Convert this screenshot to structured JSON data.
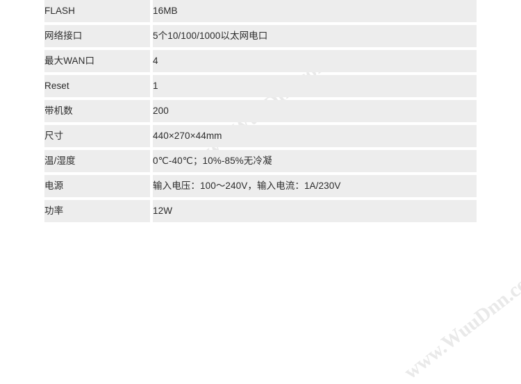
{
  "document": {
    "type": "product-specification-table",
    "columns": [
      "spec_name",
      "spec_value"
    ],
    "background_color": "#ffffff",
    "cell_color": "#ededed",
    "text_color": "#2b2b2b"
  },
  "watermarks": [
    {
      "text": "www.WuuDnn.com",
      "color": "#e9e9e9",
      "rotation": "-38deg"
    },
    {
      "text": "www.WuuDnn.com",
      "color": "#e9e9e9",
      "rotation": "-38deg"
    }
  ],
  "spec_rows": [
    {
      "label": "FLASH",
      "value": "16MB"
    },
    {
      "label": "网络接口",
      "value": "5个10/100/1000以太网电口"
    },
    {
      "label": "最大WAN口",
      "value": "4"
    },
    {
      "label": "Reset",
      "value": "1"
    },
    {
      "label": "带机数",
      "value": "200"
    },
    {
      "label": "尺寸",
      "value": "440×270×44mm"
    },
    {
      "label": "温/湿度",
      "value": "0℃-40℃；10%-85%无冷凝"
    },
    {
      "label": "电源",
      "value": "输入电压：100～240V，输入电流：1A/230V"
    },
    {
      "label": "功率",
      "value": "12W"
    }
  ]
}
